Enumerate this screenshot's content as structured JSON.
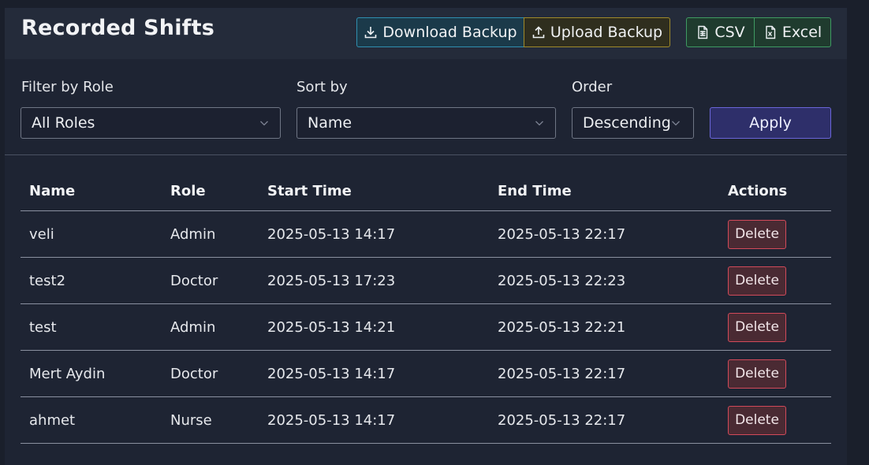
{
  "header": {
    "title": "Recorded Shifts",
    "download_label": "Download Backup",
    "upload_label": "Upload Backup",
    "csv_label": "CSV",
    "excel_label": "Excel"
  },
  "filters": {
    "role_label": "Filter by Role",
    "role_value": "All Roles",
    "sort_label": "Sort by",
    "sort_value": "Name",
    "order_label": "Order",
    "order_value": "Descending",
    "apply_label": "Apply"
  },
  "table": {
    "columns": [
      "Name",
      "Role",
      "Start Time",
      "End Time",
      "Actions"
    ],
    "rows": [
      {
        "name": "veli",
        "role": "Admin",
        "start": "2025-05-13 14:17",
        "end": "2025-05-13 22:17",
        "action": "Delete"
      },
      {
        "name": "test2",
        "role": "Doctor",
        "start": "2025-05-13 17:23",
        "end": "2025-05-13 22:23",
        "action": "Delete"
      },
      {
        "name": "test",
        "role": "Admin",
        "start": "2025-05-13 14:21",
        "end": "2025-05-13 22:21",
        "action": "Delete"
      },
      {
        "name": "Mert Aydin",
        "role": "Doctor",
        "start": "2025-05-13 14:17",
        "end": "2025-05-13 22:17",
        "action": "Delete"
      },
      {
        "name": "ahmet",
        "role": "Nurse",
        "start": "2025-05-13 14:17",
        "end": "2025-05-13 22:17",
        "action": "Delete"
      }
    ]
  },
  "icons": {
    "download": "download-icon",
    "upload": "upload-icon",
    "csv": "file-spreadsheet-icon",
    "excel": "file-excel-icon",
    "dropdown": "chevron-down-icon"
  },
  "colors": {
    "background": "#1a1f2b",
    "download_accent": "#2f8fb0",
    "upload_accent": "#a08a2a",
    "export_accent": "#3f9a62",
    "apply_accent": "#6a65d8",
    "delete_accent": "#d24a5a"
  }
}
